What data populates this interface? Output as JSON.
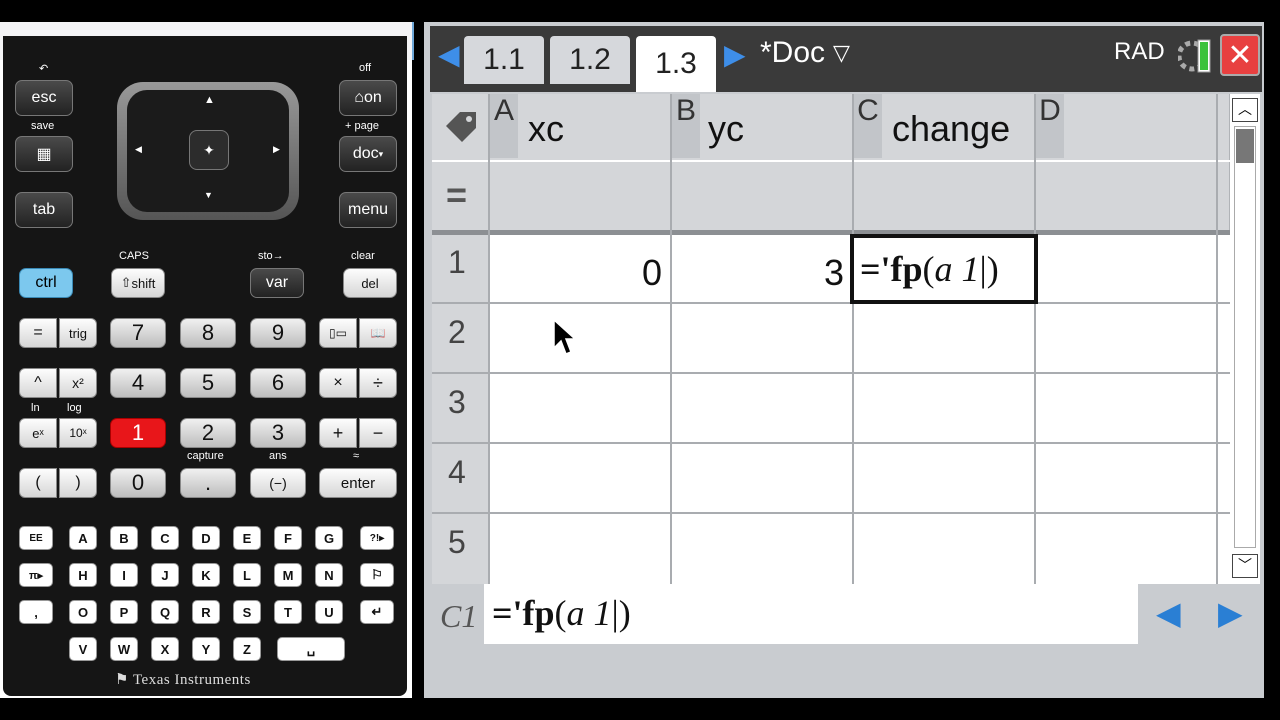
{
  "calculator": {
    "keys": {
      "esc": "esc",
      "on": "on",
      "doc": "doc",
      "menu": "menu",
      "tab": "tab",
      "ctrl": "ctrl",
      "shift": "shift",
      "var": "var",
      "del": "del",
      "equals": "=",
      "trig": "trig",
      "n7": "7",
      "n8": "8",
      "n9": "9",
      "n4": "4",
      "n5": "5",
      "n6": "6",
      "n1": "1",
      "n2": "2",
      "n3": "3",
      "n0": "0",
      "power": "^",
      "square": "x²",
      "times": "×",
      "divide": "÷",
      "exp": "eˣ",
      "ten_pow": "10ˣ",
      "plus": "+",
      "minus": "−",
      "lparen": "(",
      "rparen": ")",
      "dot": ".",
      "neg": "(−)",
      "enter": "enter",
      "ee": "EE",
      "pi": "π▸",
      "comma": ",",
      "ans_q": "?!▸"
    },
    "alpha_rows": [
      [
        "A",
        "B",
        "C",
        "D",
        "E",
        "F",
        "G"
      ],
      [
        "H",
        "I",
        "J",
        "K",
        "L",
        "M",
        "N"
      ],
      [
        "O",
        "P",
        "Q",
        "R",
        "S",
        "T",
        "U"
      ],
      [
        "V",
        "W",
        "X",
        "Y",
        "Z"
      ]
    ],
    "secondary_labels": {
      "off": "off",
      "save": "save",
      "add_page": "+ page",
      "caps": "CAPS",
      "sto": "sto→",
      "clear": "clear",
      "ln": "ln",
      "log": "log",
      "capture": "capture",
      "ans": "ans",
      "approx": "≈"
    },
    "brand": "Texas Instruments"
  },
  "app": {
    "tabs": [
      "1.1",
      "1.2",
      "1.3"
    ],
    "active_tab": "1.3",
    "doc_title": "*Doc",
    "angle_mode": "RAD",
    "columns": [
      {
        "letter": "A",
        "name": "xc"
      },
      {
        "letter": "B",
        "name": "yc"
      },
      {
        "letter": "C",
        "name": "change"
      },
      {
        "letter": "D",
        "name": ""
      }
    ],
    "formula_row_symbol": "=",
    "rows": [
      {
        "num": "1",
        "a": "0",
        "b": "3"
      },
      {
        "num": "2",
        "a": "",
        "b": ""
      },
      {
        "num": "3",
        "a": "",
        "b": ""
      },
      {
        "num": "4",
        "a": "",
        "b": ""
      },
      {
        "num": "5",
        "a": "",
        "b": ""
      }
    ],
    "active_cell": "C1",
    "formula": {
      "prefix": "='",
      "func": "fp",
      "arg": "a 1"
    },
    "colors": {
      "accent": "#2a7fd4",
      "close": "#e84040",
      "battery": "#3cc23c"
    }
  }
}
